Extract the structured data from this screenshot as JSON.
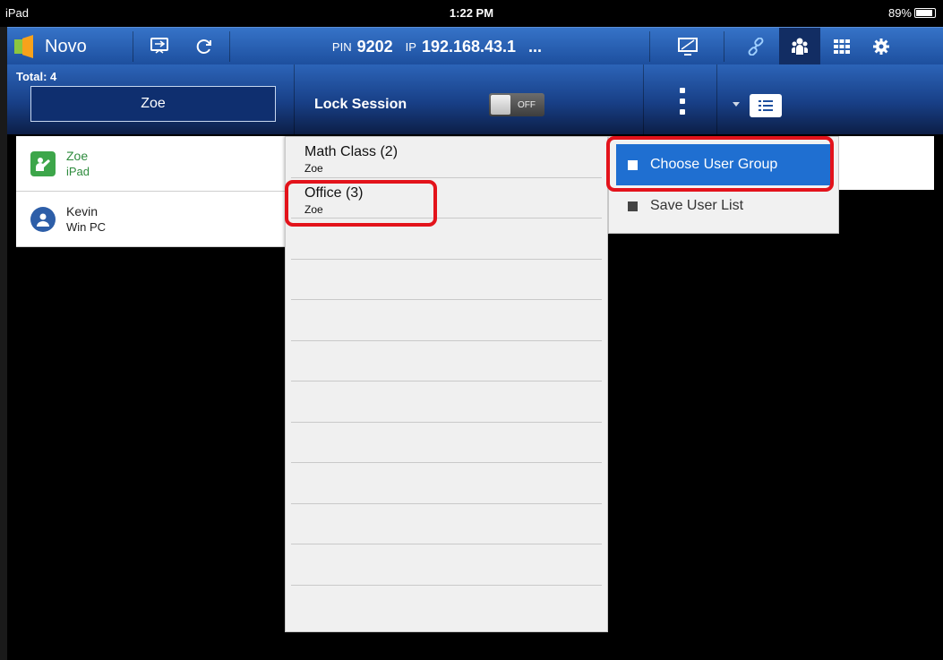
{
  "status_bar": {
    "device": "iPad",
    "time": "1:22 PM",
    "battery": "89%"
  },
  "top_bar": {
    "app_name": "Novo",
    "pin_label": "PIN",
    "pin": "9202",
    "ip_label": "IP",
    "ip": "192.168.43.1",
    "more": "...",
    "icons": [
      "presentation-icon",
      "refresh-icon",
      "monitor-icon",
      "link-icon",
      "users-icon",
      "grid-icon",
      "gear-icon"
    ]
  },
  "sub_bar": {
    "total": "Total: 4",
    "presenter": "Zoe",
    "lock_label": "Lock Session",
    "lock_toggle": "OFF"
  },
  "users": [
    {
      "name": "Zoe",
      "device": "iPad",
      "role": "presenter"
    },
    {
      "name": "Kevin",
      "device": "Win PC",
      "role": "attendee"
    }
  ],
  "groups": [
    {
      "title": "Math Class (2)",
      "owner": "Zoe"
    },
    {
      "title": "Office (3)",
      "owner": "Zoe"
    }
  ],
  "menu": {
    "choose_group": "Choose User Group",
    "save_list": "Save User List"
  },
  "colors": {
    "accent": "#1f6fd1",
    "highlight": "#e3131b",
    "presenter_green": "#2e8b3d"
  }
}
